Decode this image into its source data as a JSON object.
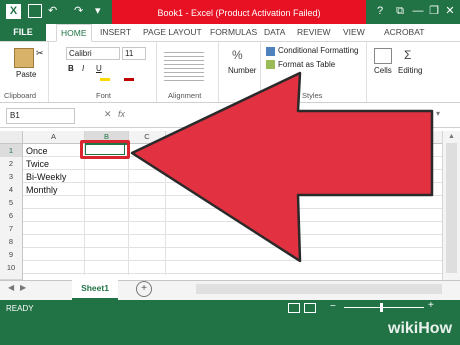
{
  "titlebar": {
    "app_icon": "X",
    "undo_icon": "undo-arrow",
    "redo_icon": "redo-arrow",
    "title": "Book1 - Excel (Product Activation Failed)",
    "help": "?",
    "minimize": "—",
    "restore": "❐",
    "close": "✕"
  },
  "tabs": {
    "file": "FILE",
    "home": "HOME",
    "insert": "INSERT",
    "page_layout": "PAGE LAYOUT",
    "formulas": "FORMULAS",
    "data": "DATA",
    "review": "REVIEW",
    "view": "VIEW",
    "acrobat": "ACROBAT"
  },
  "ribbon": {
    "paste": "Paste",
    "clipboard": "Clipboard",
    "font_name": "Calibri",
    "font_size": "11",
    "bold": "B",
    "italic": "I",
    "underline": "U",
    "font": "Font",
    "alignment": "Alignment",
    "number": "Number",
    "conditional_formatting": "Conditional Formatting",
    "format_as_table": "Format as Table",
    "styles": "Styles",
    "cells": "Cells",
    "editing": "Editing"
  },
  "formula_bar": {
    "name_box": "B1",
    "cancel": "✕",
    "fx": "fx"
  },
  "grid": {
    "columns": [
      "A",
      "B",
      "C"
    ],
    "rows": [
      "1",
      "2",
      "3",
      "4",
      "5",
      "6",
      "7",
      "8",
      "9",
      "10"
    ],
    "cells": [
      "Once",
      "Twice",
      "Bi-Weekly",
      "Monthly"
    ]
  },
  "sheet": {
    "tab": "Sheet1",
    "add": "+"
  },
  "status": {
    "ready": "READY",
    "zoom_minus": "−",
    "zoom_plus": "+",
    "watermark": "wikiHow"
  },
  "colors": {
    "excel_green": "#217346",
    "banner_red": "#e81123",
    "arrow_red": "#e23140"
  }
}
